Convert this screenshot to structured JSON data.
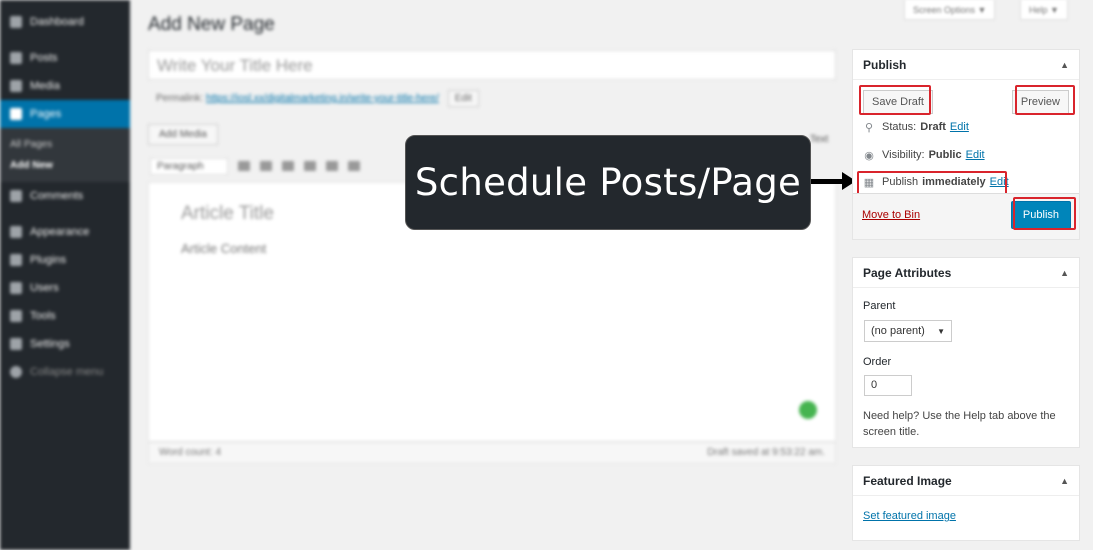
{
  "sidebar": {
    "items": [
      {
        "label": "Dashboard",
        "icon": "dashboard-icon"
      },
      {
        "label": "Posts",
        "icon": "pin-icon"
      },
      {
        "label": "Media",
        "icon": "media-icon"
      },
      {
        "label": "Pages",
        "icon": "pages-icon"
      },
      {
        "label": "Comments",
        "icon": "comments-icon"
      },
      {
        "label": "Appearance",
        "icon": "appearance-icon"
      },
      {
        "label": "Plugins",
        "icon": "plugins-icon"
      },
      {
        "label": "Users",
        "icon": "users-icon"
      },
      {
        "label": "Tools",
        "icon": "tools-icon"
      },
      {
        "label": "Settings",
        "icon": "settings-icon"
      },
      {
        "label": "Collapse menu",
        "icon": "collapse-icon"
      }
    ],
    "submenu": [
      "All Pages",
      "Add New"
    ]
  },
  "top": {
    "screen_options": "Screen Options ▼",
    "help": "Help ▼"
  },
  "editor": {
    "heading": "Add New Page",
    "title_placeholder": "Write Your Title Here",
    "permalink_label": "Permalink:",
    "permalink_url": "https://iosl.xx/digitalmarketing.in/write-your-title-here/",
    "permalink_edit": "Edit",
    "add_media": "Add Media",
    "format_select": "Paragraph",
    "text_tab": "Text",
    "article_title": "Article Title",
    "article_content": "Article Content",
    "word_count": "Word count: 4",
    "draft_saved": "Draft saved at 9:53:22 am."
  },
  "callout": {
    "text": "Schedule Posts/Page"
  },
  "publish": {
    "title": "Publish",
    "save_draft": "Save Draft",
    "preview": "Preview",
    "status_label": "Status:",
    "status_value": "Draft",
    "visibility_label": "Visibility:",
    "visibility_value": "Public",
    "schedule_label": "Publish",
    "schedule_value": "immediately",
    "edit": "Edit",
    "move_to_bin": "Move to Bin",
    "publish_button": "Publish"
  },
  "page_attributes": {
    "title": "Page Attributes",
    "parent_label": "Parent",
    "parent_value": "(no parent)",
    "order_label": "Order",
    "order_value": "0",
    "help_text": "Need help? Use the Help tab above the screen title."
  },
  "featured_image": {
    "title": "Featured Image",
    "link": "Set featured image"
  },
  "colors": {
    "accent": "#0085ba",
    "highlight": "#d9242c",
    "sidebar": "#23282d"
  }
}
